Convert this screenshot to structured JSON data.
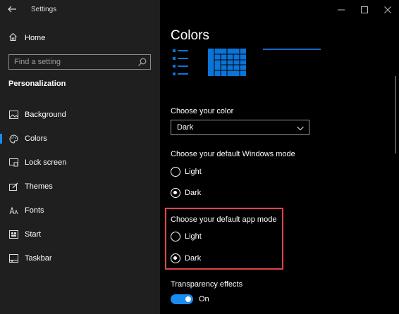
{
  "window": {
    "title": "Settings",
    "back_icon": "back-arrow-icon",
    "controls": [
      "minimize-icon",
      "maximize-icon",
      "close-icon"
    ]
  },
  "sidebar": {
    "home_label": "Home",
    "search_placeholder": "Find a setting",
    "section_title": "Personalization",
    "items": [
      {
        "label": "Background",
        "icon": "picture-icon",
        "active": false
      },
      {
        "label": "Colors",
        "icon": "palette-icon",
        "active": true
      },
      {
        "label": "Lock screen",
        "icon": "lock-screen-icon",
        "active": false
      },
      {
        "label": "Themes",
        "icon": "brush-icon",
        "active": false
      },
      {
        "label": "Fonts",
        "icon": "font-icon",
        "active": false
      },
      {
        "label": "Start",
        "icon": "start-icon",
        "active": false
      },
      {
        "label": "Taskbar",
        "icon": "taskbar-icon",
        "active": false
      }
    ]
  },
  "main": {
    "page_title": "Colors",
    "choose_color_label": "Choose your color",
    "choose_color_value": "Dark",
    "windows_mode": {
      "label": "Choose your default Windows mode",
      "options": [
        {
          "label": "Light",
          "selected": false
        },
        {
          "label": "Dark",
          "selected": true
        }
      ]
    },
    "app_mode": {
      "label": "Choose your default app mode",
      "options": [
        {
          "label": "Light",
          "selected": false
        },
        {
          "label": "Dark",
          "selected": true
        }
      ]
    },
    "transparency": {
      "label": "Transparency effects",
      "state": "On"
    }
  },
  "colors": {
    "accent": "#1a8cf0",
    "highlight": "#e0444a",
    "sidebar_bg": "#1f1f1f",
    "main_bg": "#000000"
  }
}
